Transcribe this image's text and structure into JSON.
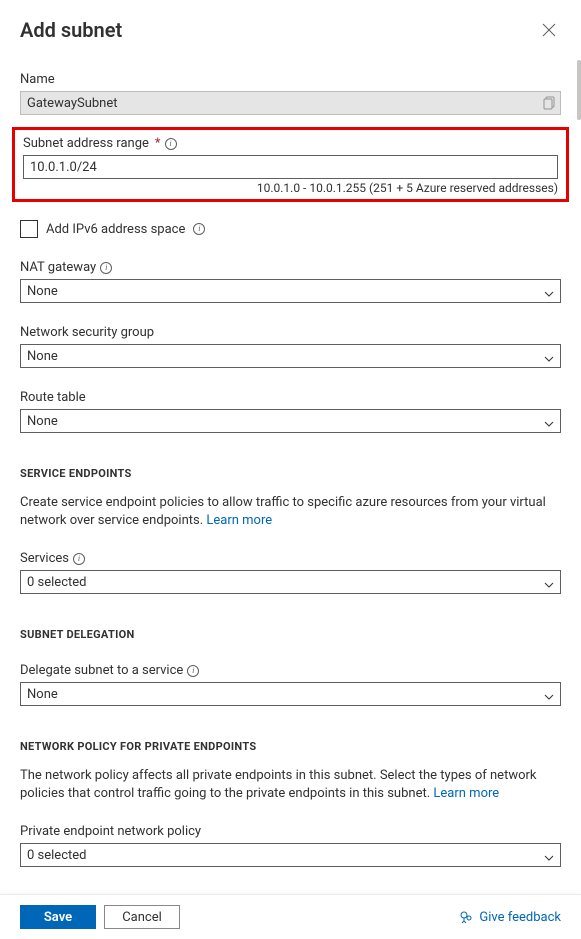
{
  "header": {
    "title": "Add subnet"
  },
  "name": {
    "label": "Name",
    "value": "GatewaySubnet"
  },
  "addressRange": {
    "label": "Subnet address range",
    "value": "10.0.1.0/24",
    "hint": "10.0.1.0 - 10.0.1.255 (251 + 5 Azure reserved addresses)"
  },
  "ipv6": {
    "label": "Add IPv6 address space"
  },
  "natGateway": {
    "label": "NAT gateway",
    "value": "None"
  },
  "nsg": {
    "label": "Network security group",
    "value": "None"
  },
  "routeTable": {
    "label": "Route table",
    "value": "None"
  },
  "serviceEndpoints": {
    "title": "SERVICE ENDPOINTS",
    "description": "Create service endpoint policies to allow traffic to specific azure resources from your virtual network over service endpoints. ",
    "learnMore": "Learn more",
    "servicesLabel": "Services",
    "servicesValue": "0 selected"
  },
  "delegation": {
    "title": "SUBNET DELEGATION",
    "label": "Delegate subnet to a service",
    "value": "None"
  },
  "networkPolicy": {
    "title": "NETWORK POLICY FOR PRIVATE ENDPOINTS",
    "description": "The network policy affects all private endpoints in this subnet. Select the types of network policies that control traffic going to the private endpoints in this subnet. ",
    "learnMore": "Learn more",
    "label": "Private endpoint network policy",
    "value": "0 selected"
  },
  "footer": {
    "save": "Save",
    "cancel": "Cancel",
    "feedback": "Give feedback"
  }
}
